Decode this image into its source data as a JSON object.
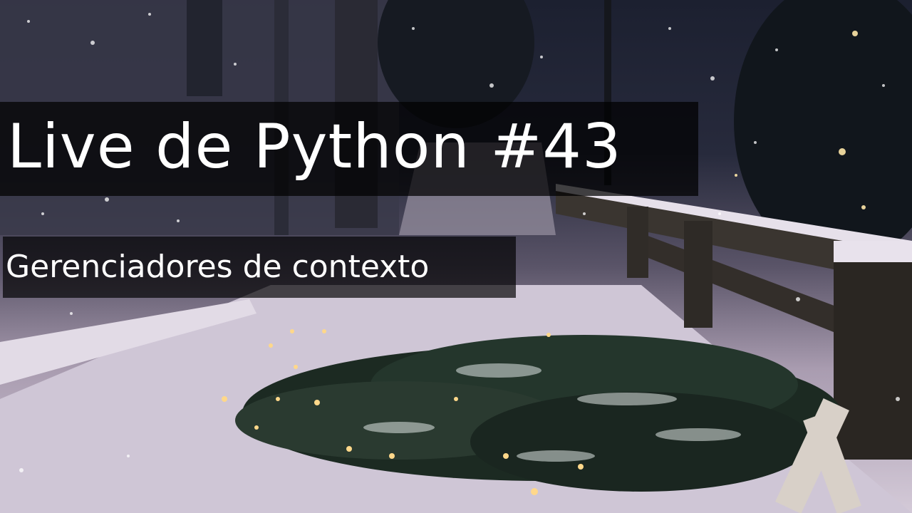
{
  "title": "Live de Python #43",
  "subtitle": "Gerenciadores de contexto",
  "colors": {
    "text": "#ffffff",
    "banner": "#000000"
  }
}
